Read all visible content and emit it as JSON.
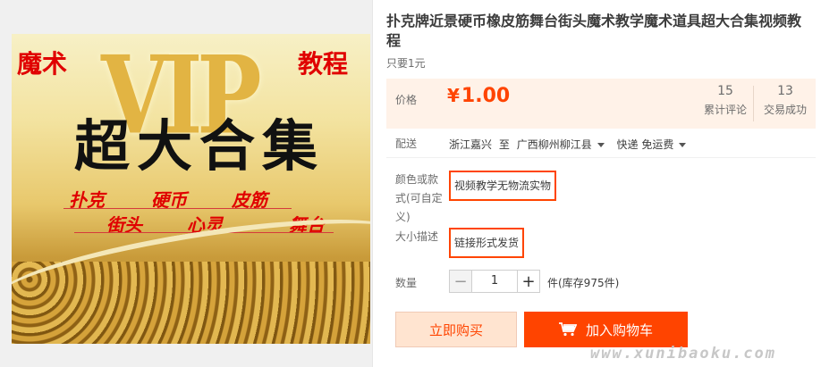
{
  "product": {
    "title": "扑克牌近景硬币橡皮筋舞台街头魔术教学魔术道具超大合集视频教程",
    "subtitle": "只要1元"
  },
  "image": {
    "vip": "VIP",
    "left_tag": "魔术",
    "right_tag": "教程",
    "main_text": "超大合集",
    "line1": [
      "扑克",
      "硬币",
      "皮筋"
    ],
    "line2": [
      "街头",
      "心灵",
      "舞台"
    ]
  },
  "price": {
    "label": "价格",
    "currency": "¥",
    "value": "1.00",
    "reviews_count": "15",
    "reviews_label": "累计评论",
    "deals_count": "13",
    "deals_label": "交易成功"
  },
  "shipping": {
    "label": "配送",
    "from": "浙江嘉兴",
    "to_word": "至",
    "destination": "广西柳州柳江县",
    "method": "快递 免运费"
  },
  "sku": {
    "color_label": "颜色或款式(可自定义)",
    "color_option": "视频教学无物流实物",
    "size_label": "大小描述",
    "size_option": "链接形式发货"
  },
  "quantity": {
    "label": "数量",
    "value": "1",
    "stock": "件(库存975件)"
  },
  "actions": {
    "buy_now": "立即购买",
    "add_to_cart": "加入购物车"
  },
  "watermark": "www.xunibaoku.com",
  "colors": {
    "accent": "#ff4400",
    "price_bg": "#fff2e8",
    "buy_bg": "#ffe4d0"
  }
}
